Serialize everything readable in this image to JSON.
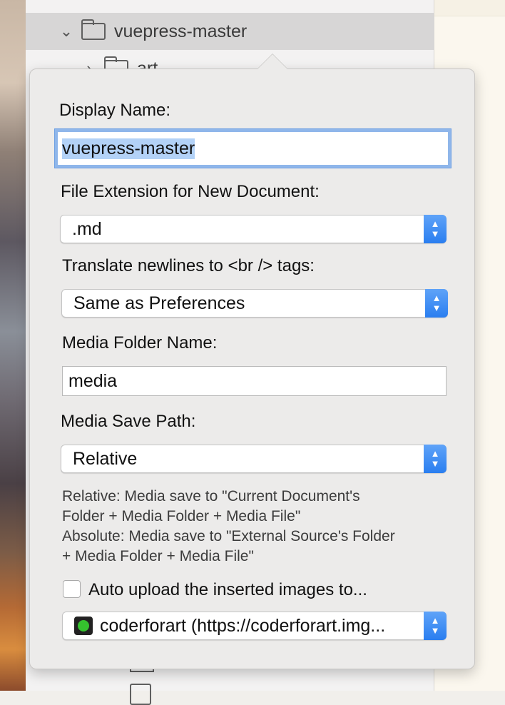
{
  "sidebar": {
    "items": [
      {
        "label": "vuepress-master",
        "expanded": true,
        "selected": true
      },
      {
        "label": "art",
        "expanded": false,
        "selected": false
      }
    ]
  },
  "popover": {
    "display_name_label": "Display Name:",
    "display_name_value": "vuepress-master",
    "file_extension_label": "File Extension for New Document:",
    "file_extension_value": ".md",
    "newlines_label": "Translate newlines to <br /> tags:",
    "newlines_value": "Same as Preferences",
    "media_folder_label": "Media Folder Name:",
    "media_folder_value": "media",
    "media_save_path_label": "Media Save Path:",
    "media_save_path_value": "Relative",
    "help_lines": [
      "Relative: Media save to \"Current Document's",
      "Folder + Media Folder + Media File\"",
      "Absolute: Media save to \"External Source's Folder",
      "+ Media Folder + Media File\""
    ],
    "auto_upload_label": "Auto upload the inserted images to...",
    "auto_upload_checked": false,
    "upload_target_value": "coderforart (https://coderforart.img...",
    "upload_status_color": "#35c22e"
  },
  "colors": {
    "accent": "#2a7ef0",
    "focus_ring": "#8fb6ea",
    "selection": "#b3d2f7"
  }
}
